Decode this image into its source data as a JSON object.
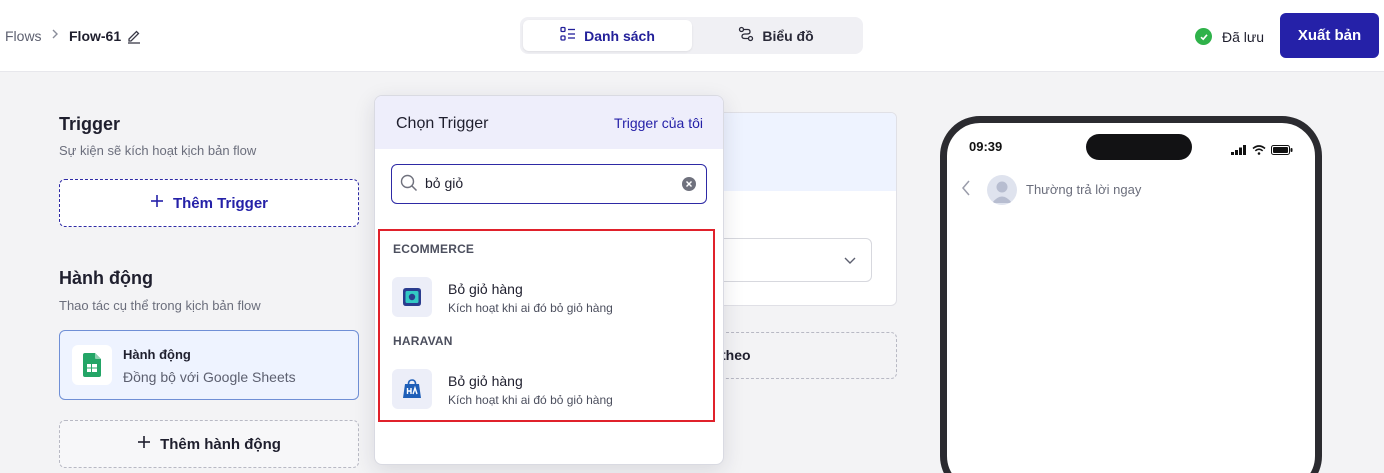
{
  "header": {
    "breadcrumb_root": "Flows",
    "breadcrumb_current": "Flow-61",
    "view_tabs": [
      {
        "label": "Danh sách",
        "active": true
      },
      {
        "label": "Biểu đồ",
        "active": false
      }
    ],
    "save_status": "Đã lưu",
    "publish_label": "Xuất bản"
  },
  "trigger_section": {
    "title": "Trigger",
    "subtitle": "Sự kiện sẽ kích hoạt kịch bản flow",
    "add_label": "Thêm Trigger"
  },
  "action_section": {
    "title": "Hành động",
    "subtitle": "Thao tác cụ thể trong kịch bản flow",
    "card_title": "Hành động",
    "card_subtitle": "Đồng bộ với Google Sheets",
    "add_label": "Thêm hành động"
  },
  "middle": {
    "dashed_partial_text": "theo"
  },
  "popover": {
    "title": "Chọn Trigger",
    "my_triggers_link": "Trigger của tôi",
    "search_value": "bỏ giỏ",
    "groups": [
      {
        "label": "ECOMMERCE",
        "items": [
          {
            "title": "Bỏ giỏ hàng",
            "subtitle": "Kích hoạt khi ai đó bỏ giỏ hàng",
            "icon": "ecommerce-logo-icon"
          }
        ]
      },
      {
        "label": "HARAVAN",
        "items": [
          {
            "title": "Bỏ giỏ hàng",
            "subtitle": "Kích hoạt khi ai đó bỏ giỏ hàng",
            "icon": "haravan-logo-icon"
          }
        ]
      }
    ]
  },
  "phone": {
    "time": "09:39",
    "chat_status": "Thường trả lời ngay"
  },
  "colors": {
    "primary": "#2521a8",
    "success": "#2fb24a",
    "highlight_border": "#e0212b"
  }
}
